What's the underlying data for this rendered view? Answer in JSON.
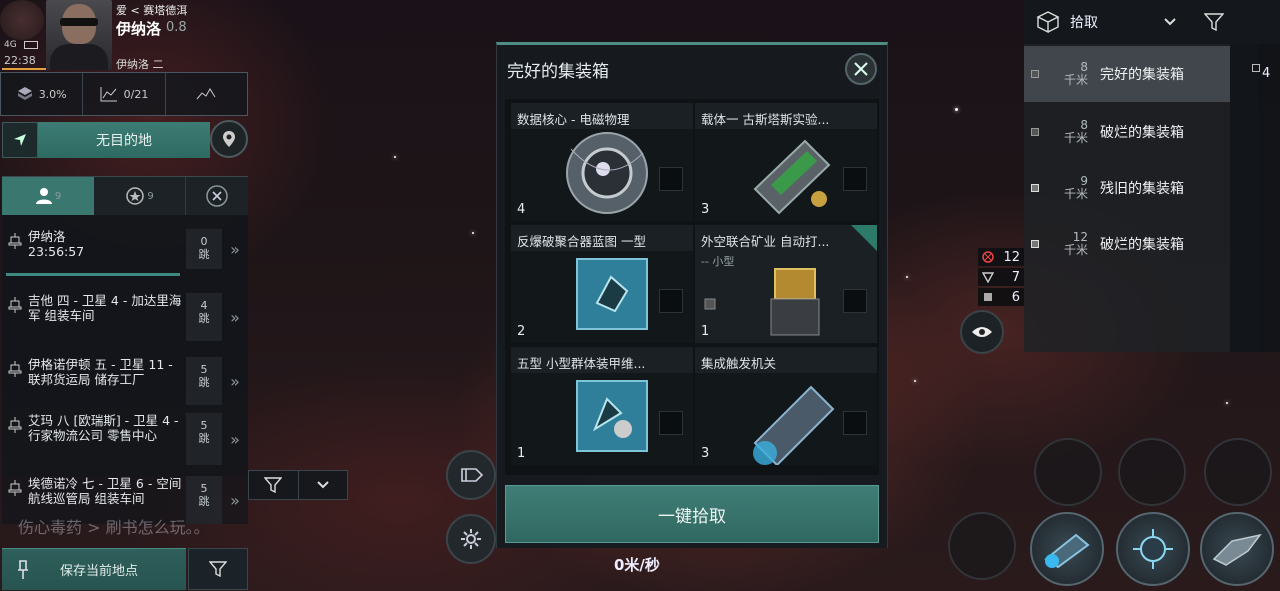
{
  "character": {
    "location_prefix": "爱",
    "location": "< 赛塔德洱",
    "name": "伊纳洛",
    "security": "0.8",
    "system": "伊纳洛 二",
    "network": "4G",
    "time": "22:38"
  },
  "stats": {
    "cargo": "3.0%",
    "chart": "0/21"
  },
  "destination": {
    "label": "无目的地"
  },
  "route": {
    "tab_personal_count": "9",
    "tab_corp_count": "9",
    "items": [
      {
        "text": "伊纳洛\n23:56:57",
        "jumps": "0\n跳"
      },
      {
        "text": "吉他 四 - 卫星 4 - 加达里海军 组装车间",
        "jumps": "4\n跳"
      },
      {
        "text": "伊格诺伊顿 五 - 卫星 11 - 联邦货运局 储存工厂",
        "jumps": "5\n跳"
      },
      {
        "text": "艾玛 八 [欧瑞斯] - 卫星 4 - 行家物流公司 零售中心",
        "jumps": "5\n跳"
      },
      {
        "text": "埃德诺冷 七 - 卫星 6 - 空间航线巡管局 组装车间",
        "jumps": "5\n跳"
      }
    ]
  },
  "chat": {
    "line1": "伤心毒药 > 刷书怎么玩。。"
  },
  "save_location": {
    "label": "保存当前地点"
  },
  "container": {
    "title": "完好的集装箱",
    "items": [
      {
        "name": "数据核心 - 电磁物理",
        "qty": "4",
        "sub": ""
      },
      {
        "name": "载体一 古斯塔斯实验...",
        "qty": "3",
        "sub": ""
      },
      {
        "name": "反爆破聚合器蓝图 一型",
        "qty": "2",
        "sub": ""
      },
      {
        "name": "外空联合矿业 自动打...",
        "qty": "1",
        "sub": "--  小型"
      },
      {
        "name": "五型 小型群体装甲维...",
        "qty": "1",
        "sub": ""
      },
      {
        "name": "集成触发机关",
        "qty": "3",
        "sub": ""
      }
    ],
    "loot_all": "一键拾取"
  },
  "speed": {
    "value": "0米/秒"
  },
  "overview": {
    "mode": "拾取",
    "side_count": "4",
    "rows": [
      {
        "distance": "8",
        "unit": "千米",
        "name": "完好的集装箱"
      },
      {
        "distance": "8",
        "unit": "千米",
        "name": "破烂的集装箱"
      },
      {
        "distance": "9",
        "unit": "千米",
        "name": "残旧的集装箱"
      },
      {
        "distance": "12",
        "unit": "千米",
        "name": "破烂的集装箱"
      }
    ]
  },
  "counters": {
    "hostile": "12",
    "drones": "7",
    "other": "6"
  },
  "colors": {
    "accent": "#3d7c74",
    "panel": "#1a2024"
  }
}
